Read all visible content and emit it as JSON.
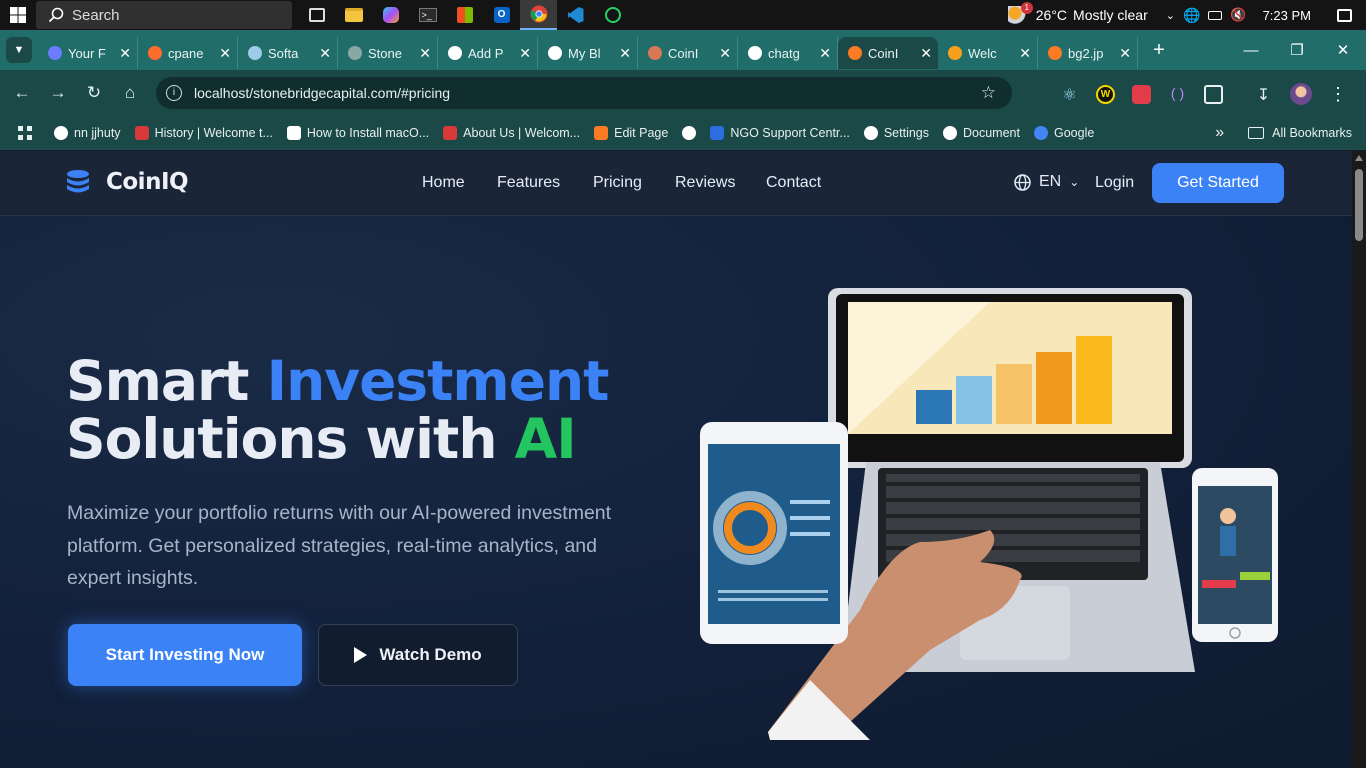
{
  "taskbar": {
    "search_placeholder": "Search",
    "weather_temp": "26°C",
    "weather_text": "Mostly clear",
    "weather_badge": "1",
    "clock": "7:23 PM"
  },
  "tabs": [
    {
      "label": "Your F",
      "icon": "infinity-icon",
      "color": "#6a7cff"
    },
    {
      "label": "cpane",
      "icon": "cpanel-icon",
      "color": "#ff6c2c"
    },
    {
      "label": "Softa",
      "icon": "chart-icon",
      "color": "#9ecbe8"
    },
    {
      "label": "Stone",
      "icon": "globe-icon",
      "color": "#8aa6a5"
    },
    {
      "label": "Add P",
      "icon": "wordpress-icon",
      "color": "#ffffff"
    },
    {
      "label": "My Bl",
      "icon": "wordpress-icon",
      "color": "#ffffff"
    },
    {
      "label": "CoinI",
      "icon": "claude-icon",
      "color": "#d97757"
    },
    {
      "label": "chatg",
      "icon": "openai-icon",
      "color": "#ffffff"
    },
    {
      "label": "CoinI",
      "icon": "xampp-icon",
      "color": "#fb7a24",
      "active": true
    },
    {
      "label": "Welc",
      "icon": "moodle-icon",
      "color": "#f7a01d"
    },
    {
      "label": "bg2.jp",
      "icon": "xampp-icon",
      "color": "#fb7a24"
    }
  ],
  "address": {
    "url": "localhost/stonebridgecapital.com/#pricing"
  },
  "bookmarks": [
    {
      "label": "nn jjhuty",
      "icon": "globe-icon",
      "color": "#ffffff"
    },
    {
      "label": "History | Welcome t...",
      "icon": "shield-icon",
      "color": "#d83a3a"
    },
    {
      "label": "How to Install macO...",
      "icon": "x-icon",
      "color": "#ffffff"
    },
    {
      "label": "About Us | Welcom...",
      "icon": "shield-icon",
      "color": "#d83a3a"
    },
    {
      "label": "Edit Page",
      "icon": "xampp-icon",
      "color": "#fb7a24"
    },
    {
      "label": "",
      "icon": "globe-icon",
      "color": "#ffffff"
    },
    {
      "label": "NGO Support Centr...",
      "icon": "ngo-icon",
      "color": "#2c6de0"
    },
    {
      "label": "Settings",
      "icon": "gear-icon",
      "color": "#ffffff"
    },
    {
      "label": "Document",
      "icon": "globe-icon",
      "color": "#ffffff"
    },
    {
      "label": "Google",
      "icon": "google-icon",
      "color": "#4285f4"
    }
  ],
  "bookmarks_more": "»",
  "bookmarks_all": "All Bookmarks",
  "site": {
    "logo": "CoinIQ",
    "menu": [
      "Home",
      "Features",
      "Pricing",
      "Reviews",
      "Contact"
    ],
    "lang": "EN",
    "login": "Login",
    "get_started": "Get Started",
    "hero": {
      "title_1a": "Smart ",
      "title_1b": "Investment",
      "title_2a": "Solutions with ",
      "title_2b": "AI",
      "subtitle": "Maximize your portfolio returns with our AI-powered investment platform. Get personalized strategies, real-time analytics, and expert insights.",
      "cta_primary": "Start Investing Now",
      "cta_secondary": "Watch Demo"
    },
    "colors": {
      "accent": "#3b82f6",
      "green": "#22c55e",
      "bg": "#12203a"
    }
  }
}
